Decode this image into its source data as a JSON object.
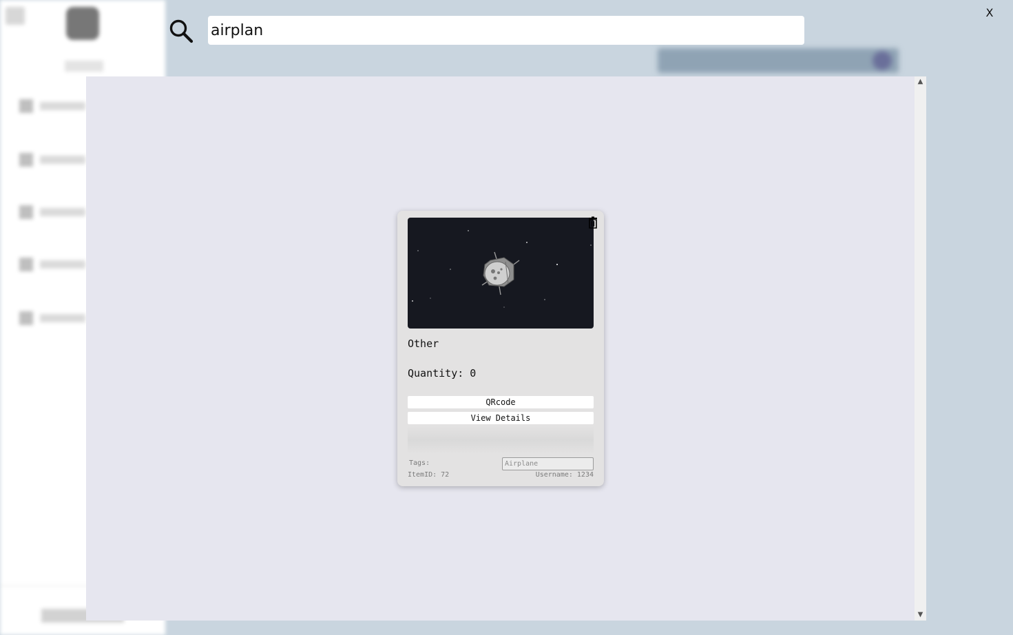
{
  "search": {
    "query": "airplan"
  },
  "overlay": {
    "close_label": "X"
  },
  "results": [
    {
      "category": "Other",
      "quantity_label": "Quantity: 0",
      "qrcode_label": "QRcode",
      "details_label": "View Details",
      "tags_label": "Tags:",
      "tags_placeholder": "Airplane",
      "item_id_label": "ItemID: 72",
      "username_label": "Username: 1234",
      "image_icon": "satellite-image"
    }
  ],
  "colors": {
    "backdrop": "#c9d5df",
    "panel": "#e6e6ef",
    "card": "#e3e2e2",
    "image_bg": "#161820"
  }
}
